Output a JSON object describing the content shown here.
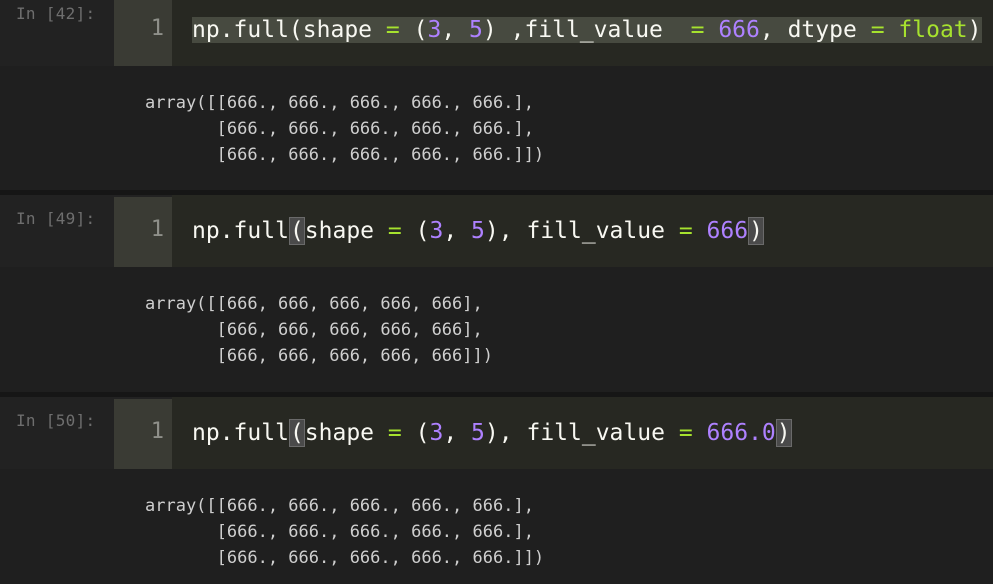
{
  "cells": [
    {
      "prompt": "In [42]:",
      "line_number": "1",
      "code": {
        "fn": "np.full(",
        "shape_kw": "shape",
        "eq1": "=",
        "tuple_open": "(",
        "n1": "3",
        "comma1": ", ",
        "n2": "5",
        "tuple_close": ") ,",
        "fill_kw": "fill_value  ",
        "eq2": "=",
        "fill_val": "666",
        "comma2": ", ",
        "dtype_kw": "dtype",
        "eq3": "=",
        "dtype_val": "float",
        "close": ")"
      },
      "output": [
        "array([[666., 666., 666., 666., 666.],",
        "       [666., 666., 666., 666., 666.],",
        "       [666., 666., 666., 666., 666.]])"
      ]
    },
    {
      "prompt": "In [49]:",
      "line_number": "1",
      "code": {
        "fn": "np.full",
        "paren": "(",
        "shape_kw": "shape",
        "eq1": "=",
        "tuple_open": "(",
        "n1": "3",
        "comma1": ", ",
        "n2": "5",
        "tuple_close": "),",
        "fill_kw": "fill_value",
        "eq2": "=",
        "fill_val": "666",
        "close": ")"
      },
      "output": [
        "array([[666, 666, 666, 666, 666],",
        "       [666, 666, 666, 666, 666],",
        "       [666, 666, 666, 666, 666]])"
      ]
    },
    {
      "prompt": "In [50]:",
      "line_number": "1",
      "code": {
        "fn": "np.full",
        "paren": "(",
        "shape_kw": "shape",
        "eq1": "=",
        "tuple_open": "(",
        "n1": "3",
        "comma1": ", ",
        "n2": "5",
        "tuple_close": "),",
        "fill_kw": "fill_value",
        "eq2": "=",
        "fill_val": "666.0",
        "close": ")"
      },
      "output": [
        "array([[666., 666., 666., 666., 666.],",
        "       [666., 666., 666., 666., 666.],",
        "       [666., 666., 666., 666., 666.]])"
      ]
    }
  ]
}
